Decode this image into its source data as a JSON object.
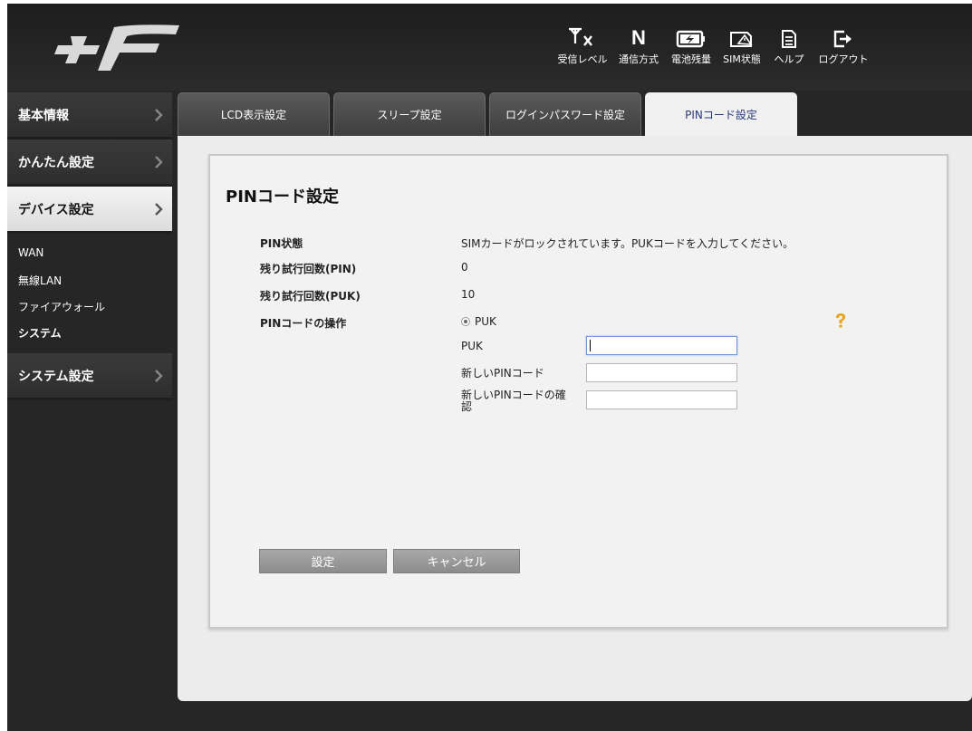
{
  "header": {
    "items": [
      {
        "label": "受信レベル",
        "icon": "signal-no-service-icon"
      },
      {
        "label": "通信方式",
        "icon": "network-type-icon",
        "glyph": "N"
      },
      {
        "label": "電池残量",
        "icon": "battery-charging-icon"
      },
      {
        "label": "SIM状態",
        "icon": "sim-status-icon"
      },
      {
        "label": "ヘルプ",
        "icon": "help-document-icon"
      },
      {
        "label": "ログアウト",
        "icon": "logout-icon"
      }
    ]
  },
  "sidebar": {
    "items": [
      {
        "label": "基本情報"
      },
      {
        "label": "かんたん設定"
      },
      {
        "label": "デバイス設定",
        "active": true
      },
      {
        "label": "システム設定"
      }
    ],
    "subitems": [
      {
        "label": "WAN"
      },
      {
        "label": "無線LAN"
      },
      {
        "label": "ファイアウォール"
      },
      {
        "label": "システム"
      }
    ]
  },
  "tabs": [
    {
      "label": "LCD表示設定"
    },
    {
      "label": "スリープ設定"
    },
    {
      "label": "ログインパスワード設定"
    },
    {
      "label": "PINコード設定",
      "active": true
    }
  ],
  "panel": {
    "title": "PINコード設定",
    "pin_status_label": "PIN状態",
    "pin_status_value": "SIMカードがロックされています。PUKコードを入力してください。",
    "pin_retries_label": "残り試行回数(PIN)",
    "pin_retries_value": "0",
    "puk_retries_label": "残り試行回数(PUK)",
    "puk_retries_value": "10",
    "operation_label": "PINコードの操作",
    "radio_option": "PUK",
    "fields": {
      "puk_label": "PUK",
      "puk_value": "",
      "new_pin_label": "新しいPINコード",
      "new_pin_value": "",
      "confirm_pin_label_line1": "新しいPINコードの確",
      "confirm_pin_label_line2": "認",
      "confirm_pin_value": ""
    },
    "buttons": {
      "submit": "設定",
      "cancel": "キャンセル"
    }
  },
  "colors": {
    "background": "#262626",
    "active_tab_text": "#2a3a7a",
    "help_icon": "#e8a317",
    "button": "#9a9a9a"
  }
}
